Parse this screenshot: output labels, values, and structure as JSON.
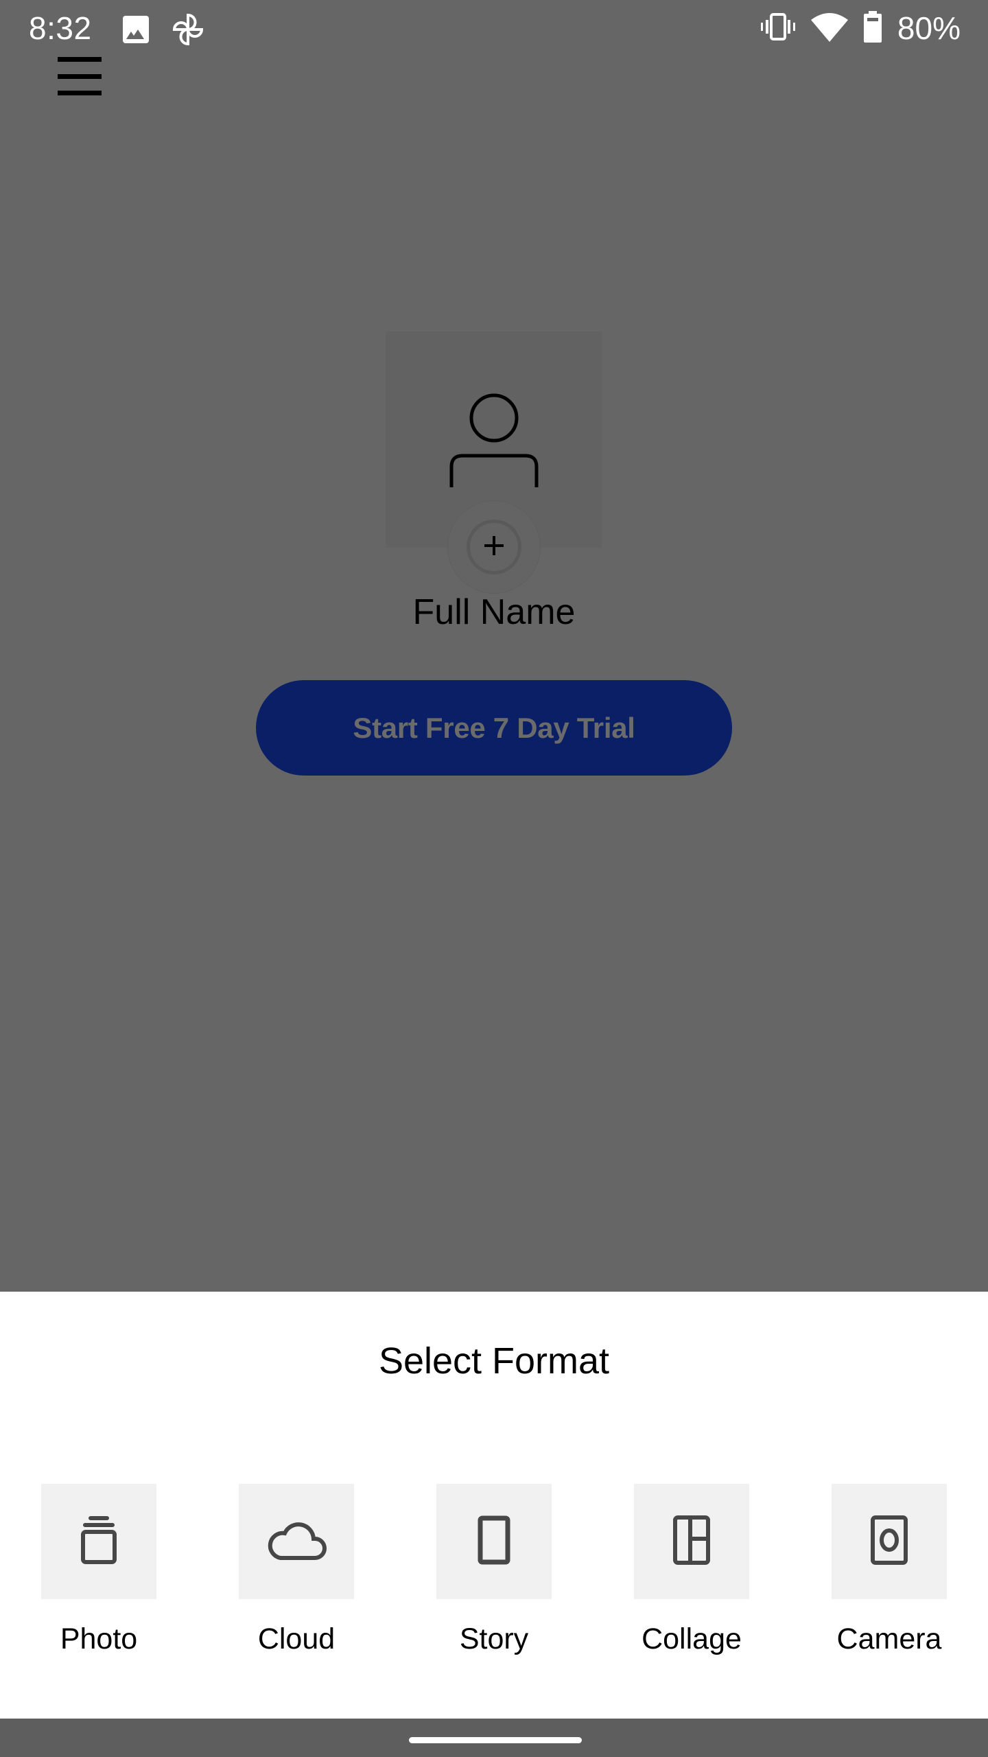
{
  "status_bar": {
    "time": "8:32",
    "left_icons": [
      "image-icon",
      "pinwheel-icon"
    ],
    "right_icons": [
      "vibrate-icon",
      "wifi-icon",
      "battery-icon"
    ],
    "battery_percent": "80%"
  },
  "header": {
    "menu_icon": "hamburger-menu-icon"
  },
  "profile": {
    "avatar_icon": "user-icon",
    "add_photo_icon": "plus-icon",
    "name": "Full Name"
  },
  "cta": {
    "label": "Start Free 7 Day Trial",
    "color": "#0a1f66"
  },
  "sheet": {
    "title": "Select Format",
    "options": [
      {
        "label": "Photo",
        "icon": "photo-stack-icon"
      },
      {
        "label": "Cloud",
        "icon": "cloud-icon"
      },
      {
        "label": "Story",
        "icon": "story-icon"
      },
      {
        "label": "Collage",
        "icon": "collage-icon"
      },
      {
        "label": "Camera",
        "icon": "camera-icon"
      }
    ]
  },
  "colors": {
    "scrim": "#666666",
    "tile_bg": "#f1f1f1",
    "tile_icon": "#474747"
  }
}
